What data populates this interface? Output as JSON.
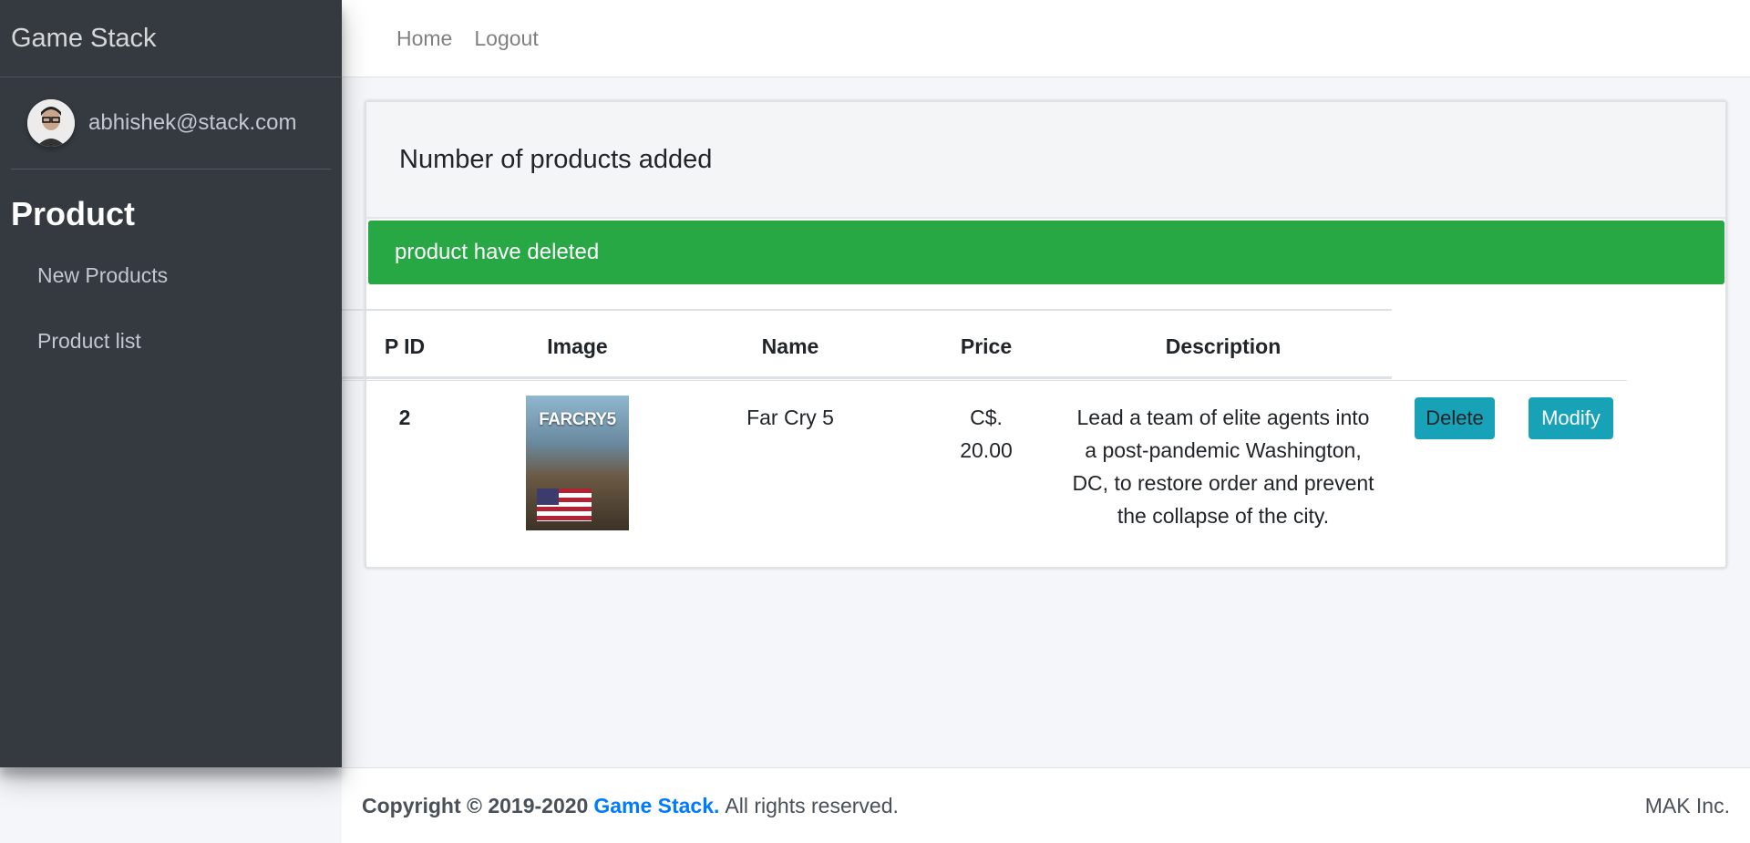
{
  "sidebar": {
    "brand_part1": "Game",
    "brand_part2": "Stack",
    "user_email": "abhishek@stack.com",
    "section_title": "Product",
    "items": [
      {
        "label": "New Products"
      },
      {
        "label": "Product list"
      }
    ]
  },
  "topnav": {
    "links": [
      {
        "label": "Home"
      },
      {
        "label": "Logout"
      }
    ]
  },
  "card": {
    "header_title": "Number of products added",
    "alert": "product have deleted",
    "table": {
      "headers": [
        "P ID",
        "Image",
        "Name",
        "Price",
        "Description"
      ],
      "rows": [
        {
          "pid": "2",
          "image_title": "FARCRY5",
          "name": "Far Cry 5",
          "price_line1": "C$.",
          "price_line2": "20.00",
          "description_lines": [
            "Lead a team of elite agents into",
            "a post-pandemic Washington,",
            "DC, to restore order and prevent",
            "the collapse of the city."
          ],
          "delete_label": "Delete",
          "modify_label": "Modify"
        }
      ]
    }
  },
  "footer": {
    "copyright": "Copyright © 2019-2020",
    "brand": "Game Stack.",
    "rights": "All rights reserved.",
    "company": "MAK Inc."
  },
  "colors": {
    "sidebar_bg": "#343a40",
    "alert_success": "#28a745",
    "button_info": "#17a2b8",
    "link_primary": "#007bff"
  }
}
